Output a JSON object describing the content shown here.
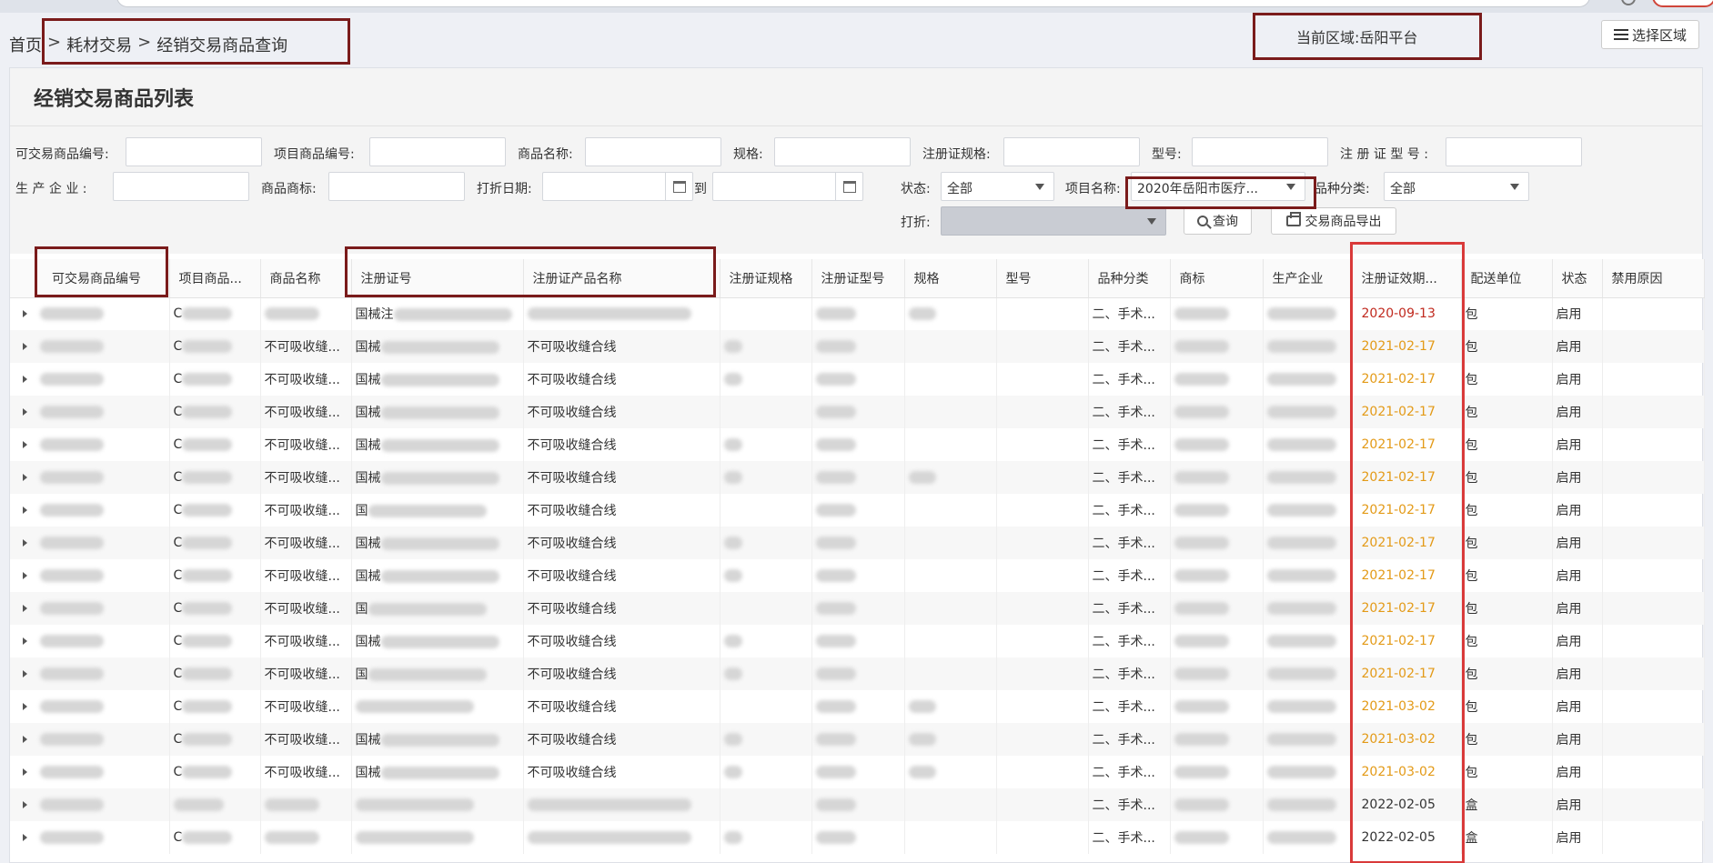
{
  "breadcrumb": {
    "home": "首页",
    "sep": ">",
    "section": "耗材交易",
    "current": "经销交易商品查询"
  },
  "region": {
    "label": "当前区域:",
    "value": "岳阳平台",
    "button_label": "选择区域"
  },
  "panel": {
    "title": "经销交易商品列表"
  },
  "filters": {
    "code_label": "可交易商品编号:",
    "project_code_label": "项目商品编号:",
    "name_label": "商品名称:",
    "spec_label": "规格:",
    "cert_spec_label": "注册证规格:",
    "model_label": "型号:",
    "cert_model_label": "注 册 证 型 号 :",
    "maker_label": "生 产 企 业 :",
    "brand_label": "商品商标:",
    "date_label": "打折日期:",
    "to_label": "到",
    "status_label": "状态:",
    "status_value": "全部",
    "project_label": "项目名称:",
    "project_value": "2020年岳阳市医疗...",
    "variety_label": "品种分类:",
    "variety_value": "全部",
    "discount_label": "打折:",
    "search_button": "查询",
    "export_button": "交易商品导出"
  },
  "table": {
    "columns": [
      "可交易商品编号",
      "项目商品...",
      "商品名称",
      "注册证号",
      "注册证产品名称",
      "注册证规格",
      "注册证型号",
      "规格",
      "型号",
      "品种分类",
      "商标",
      "生产企业",
      "注册证效期...",
      "配送单位",
      "状态",
      "禁用原因"
    ],
    "rows": [
      {
        "id": "",
        "pcode": "C",
        "name": "",
        "cert": "国械注",
        "pname": "",
        "variety": "二、手术...",
        "expiry": "2020-09-13",
        "expiry_color": "red",
        "unit": "包",
        "status": "启用"
      },
      {
        "id": "",
        "pcode": "C",
        "name": "不可吸收缝...",
        "cert": "国械",
        "pname": "不可吸收缝合线",
        "variety": "二、手术...",
        "expiry": "2021-02-17",
        "expiry_color": "orange",
        "unit": "包",
        "status": "启用"
      },
      {
        "id": "",
        "pcode": "C",
        "name": "不可吸收缝...",
        "cert": "国械",
        "pname": "不可吸收缝合线",
        "variety": "二、手术...",
        "expiry": "2021-02-17",
        "expiry_color": "orange",
        "unit": "包",
        "status": "启用"
      },
      {
        "id": "",
        "pcode": "C",
        "name": "不可吸收缝...",
        "cert": "国械",
        "pname": "不可吸收缝合线",
        "variety": "二、手术...",
        "expiry": "2021-02-17",
        "expiry_color": "orange",
        "unit": "包",
        "status": "启用"
      },
      {
        "id": "",
        "pcode": "C",
        "name": "不可吸收缝...",
        "cert": "国械",
        "pname": "不可吸收缝合线",
        "variety": "二、手术...",
        "expiry": "2021-02-17",
        "expiry_color": "orange",
        "unit": "包",
        "status": "启用"
      },
      {
        "id": "",
        "pcode": "C",
        "name": "不可吸收缝...",
        "cert": "国械",
        "pname": "不可吸收缝合线",
        "variety": "二、手术...",
        "expiry": "2021-02-17",
        "expiry_color": "orange",
        "unit": "包",
        "status": "启用"
      },
      {
        "id": "",
        "pcode": "C",
        "name": "不可吸收缝...",
        "cert": "国",
        "pname": "不可吸收缝合线",
        "variety": "二、手术...",
        "expiry": "2021-02-17",
        "expiry_color": "orange",
        "unit": "包",
        "status": "启用"
      },
      {
        "id": "",
        "pcode": "C",
        "name": "不可吸收缝...",
        "cert": "国械",
        "pname": "不可吸收缝合线",
        "variety": "二、手术...",
        "expiry": "2021-02-17",
        "expiry_color": "orange",
        "unit": "包",
        "status": "启用"
      },
      {
        "id": "",
        "pcode": "C",
        "name": "不可吸收缝...",
        "cert": "国械",
        "pname": "不可吸收缝合线",
        "variety": "二、手术...",
        "expiry": "2021-02-17",
        "expiry_color": "orange",
        "unit": "包",
        "status": "启用"
      },
      {
        "id": "",
        "pcode": "C",
        "name": "不可吸收缝...",
        "cert": "国",
        "pname": "不可吸收缝合线",
        "variety": "二、手术...",
        "expiry": "2021-02-17",
        "expiry_color": "orange",
        "unit": "包",
        "status": "启用"
      },
      {
        "id": "",
        "pcode": "C",
        "name": "不可吸收缝...",
        "cert": "国械",
        "pname": "不可吸收缝合线",
        "variety": "二、手术...",
        "expiry": "2021-02-17",
        "expiry_color": "orange",
        "unit": "包",
        "status": "启用"
      },
      {
        "id": "",
        "pcode": "C",
        "name": "不可吸收缝...",
        "cert": "国",
        "pname": "不可吸收缝合线",
        "variety": "二、手术...",
        "expiry": "2021-02-17",
        "expiry_color": "orange",
        "unit": "包",
        "status": "启用"
      },
      {
        "id": "",
        "pcode": "C",
        "name": "不可吸收缝...",
        "cert": "",
        "pname": "不可吸收缝合线",
        "variety": "二、手术...",
        "expiry": "2021-03-02",
        "expiry_color": "orange",
        "unit": "包",
        "status": "启用"
      },
      {
        "id": "",
        "pcode": "C",
        "name": "不可吸收缝...",
        "cert": "国械",
        "pname": "不可吸收缝合线",
        "variety": "二、手术...",
        "expiry": "2021-03-02",
        "expiry_color": "orange",
        "unit": "包",
        "status": "启用"
      },
      {
        "id": "",
        "pcode": "C",
        "name": "不可吸收缝...",
        "cert": "国械",
        "pname": "不可吸收缝合线",
        "variety": "二、手术...",
        "expiry": "2021-03-02",
        "expiry_color": "orange",
        "unit": "包",
        "status": "启用"
      },
      {
        "id": "",
        "pcode": "",
        "name": "",
        "cert": "",
        "pname": "",
        "variety": "二、手术...",
        "expiry": "2022-02-05",
        "expiry_color": "gray",
        "unit": "盒",
        "status": "启用"
      },
      {
        "id": "",
        "pcode": "C",
        "name": "",
        "cert": "",
        "pname": "",
        "variety": "二、手术...",
        "expiry": "2022-02-05",
        "expiry_color": "gray",
        "unit": "盒",
        "status": "启用"
      }
    ]
  }
}
